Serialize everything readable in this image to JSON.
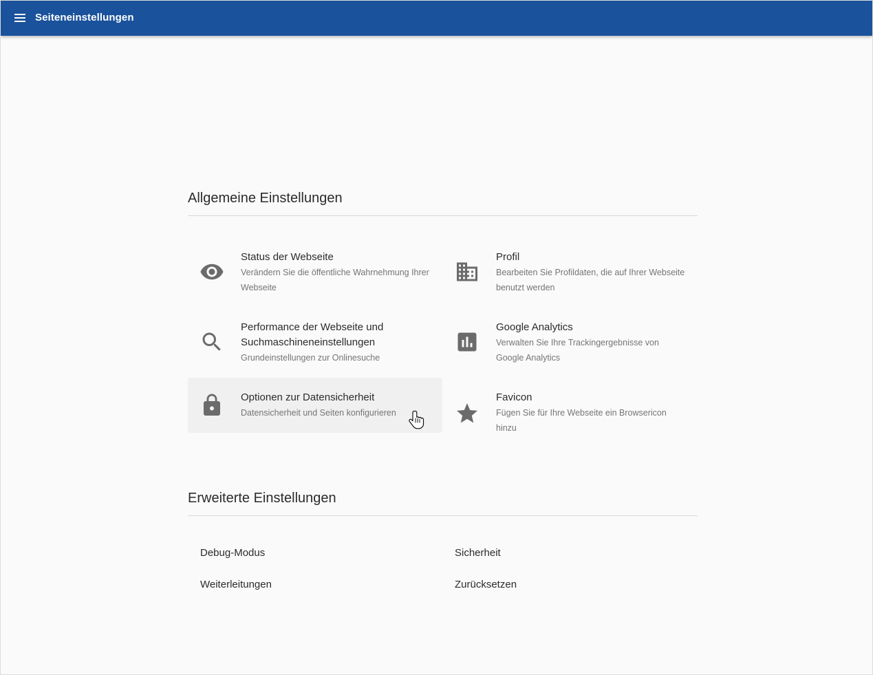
{
  "appbar": {
    "title": "Seiteneinstellungen"
  },
  "general": {
    "title": "Allgemeine Einstellungen",
    "items": [
      {
        "icon": "eye-icon",
        "title": "Status der Webseite",
        "desc": "Verändern Sie die öffentliche Wahrnehmung Ihrer Webseite"
      },
      {
        "icon": "building-icon",
        "title": "Profil",
        "desc": "Bearbeiten Sie Profildaten, die auf Ihrer Webseite benutzt werden"
      },
      {
        "icon": "search-icon",
        "title": "Performance der Webseite und Suchmaschineneinstellungen",
        "desc": "Grundeinstellungen zur Onlinesuche"
      },
      {
        "icon": "bar-chart-icon",
        "title": "Google Analytics",
        "desc": "Verwalten Sie Ihre Trackingergebnisse von Google Analytics"
      },
      {
        "icon": "lock-icon",
        "title": "Optionen zur Datensicherheit",
        "desc": "Datensicherheit und Seiten konfigurieren"
      },
      {
        "icon": "star-icon",
        "title": "Favicon",
        "desc": "Fügen Sie für Ihre Webseite ein Browsericon hinzu"
      }
    ]
  },
  "advanced": {
    "title": "Erweiterte Einstellungen",
    "items": [
      "Debug-Modus",
      "Sicherheit",
      "Weiterleitungen",
      "Zurücksetzen"
    ]
  },
  "colors": {
    "appbar": "#1a529b",
    "icon": "#6b6b6b",
    "hover": "#f0f0f0"
  }
}
